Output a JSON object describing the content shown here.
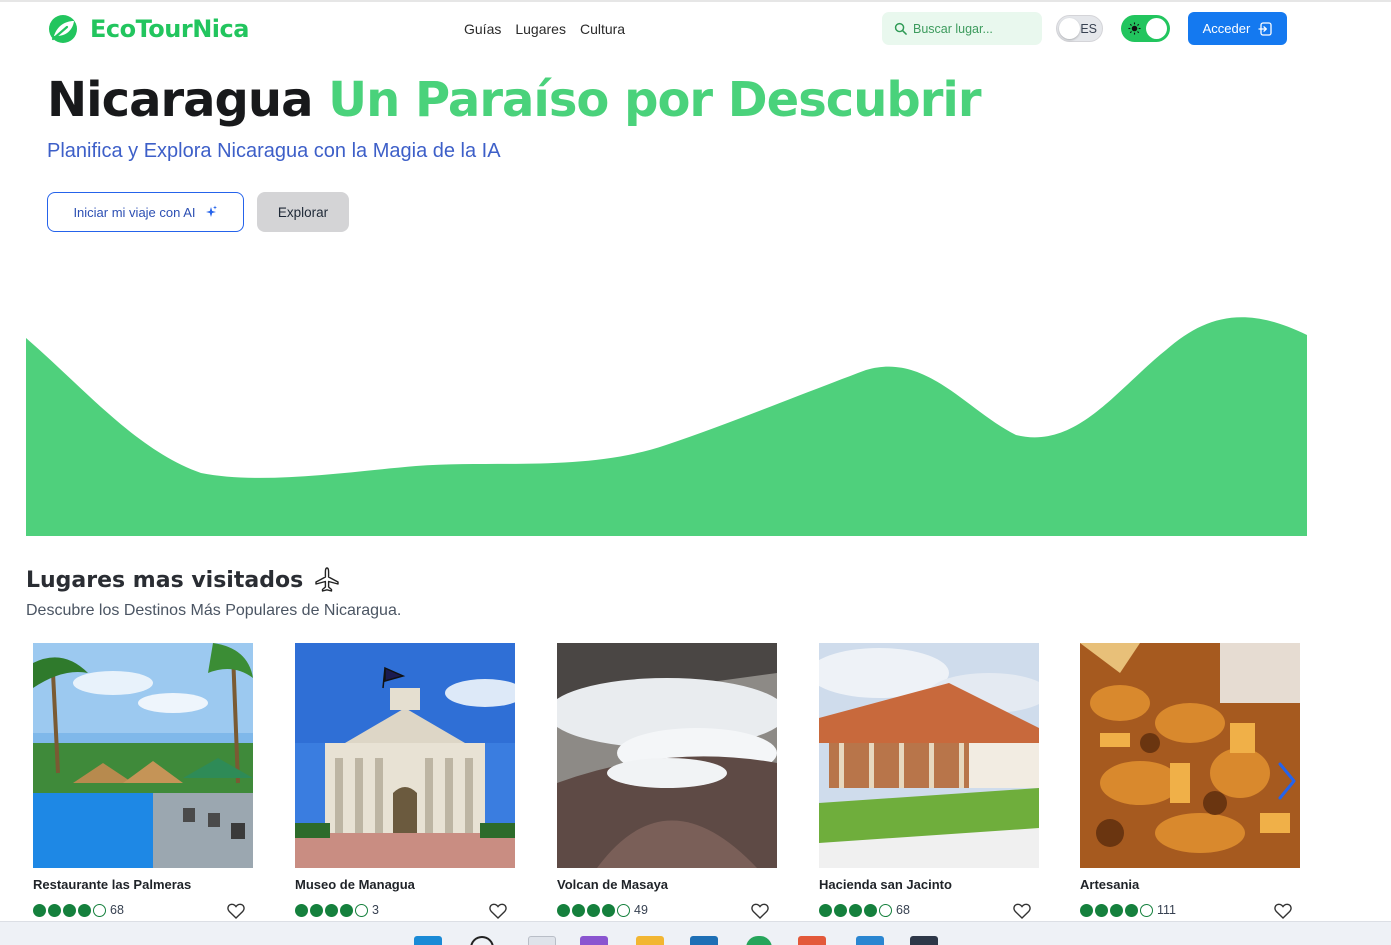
{
  "brand": {
    "name": "EcoTourNica",
    "color": "#22c55e"
  },
  "nav": {
    "links": [
      "Guías",
      "Lugares",
      "Cultura"
    ],
    "search_placeholder": "Buscar lugar...",
    "lang_label": "ES",
    "theme_toggle_on": true,
    "login_label": "Acceder"
  },
  "hero": {
    "title_dark": "Nicaragua",
    "title_green": "Un Paraíso por Descubrir",
    "subtitle": "Planifica y Explora Nicaragua con la Magia de la IA",
    "primary_button": "Iniciar mi viaje con AI",
    "secondary_button": "Explorar"
  },
  "section": {
    "title": "Lugares mas visitados",
    "subtitle": "Descubre los Destinos Más Populares de Nicaragua."
  },
  "places": [
    {
      "name": "Restaurante las Palmeras",
      "rating": 4,
      "max_rating": 5,
      "reviews": "68"
    },
    {
      "name": "Museo de Managua",
      "rating": 4,
      "max_rating": 5,
      "reviews": "3"
    },
    {
      "name": "Volcan de Masaya",
      "rating": 4,
      "max_rating": 5,
      "reviews": "49"
    },
    {
      "name": "Hacienda san Jacinto",
      "rating": 4,
      "max_rating": 5,
      "reviews": "68"
    },
    {
      "name": "Artesania",
      "rating": 4,
      "max_rating": 5,
      "reviews": "111"
    }
  ],
  "colors": {
    "accent_green": "#4ad27b",
    "primary_blue": "#1479f0",
    "rating_green": "#15803d",
    "subtitle_blue": "#3d5fc8"
  }
}
